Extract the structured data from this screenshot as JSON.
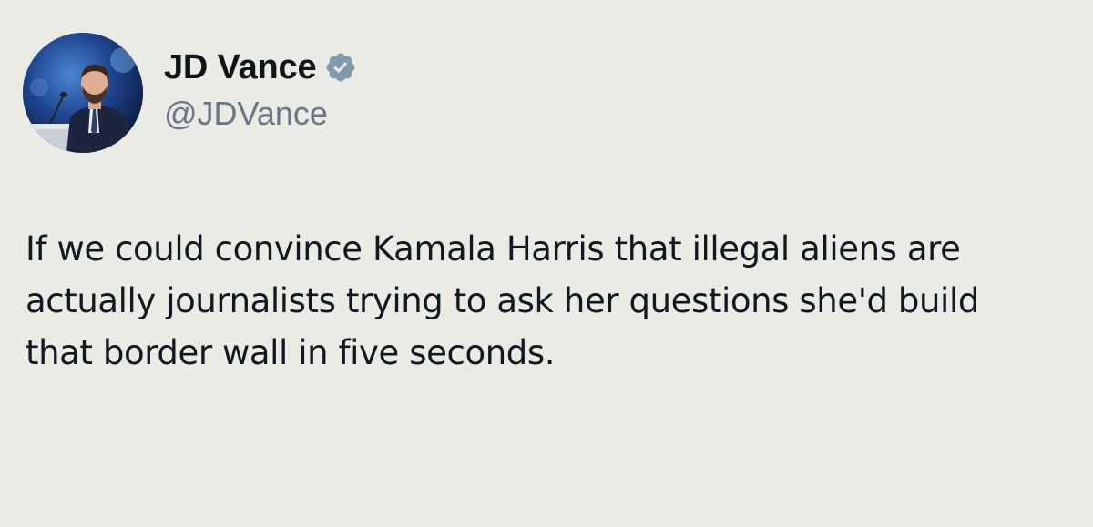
{
  "author": {
    "display_name": "JD Vance",
    "handle": "@JDVance",
    "verified_icon": "verified-badge-icon"
  },
  "tweet": {
    "text": "If we could convince Kamala Harris that illegal aliens are actually journalists trying to ask her questions she'd build that border wall in five seconds."
  },
  "colors": {
    "background": "#ebebe6",
    "text": "#111820",
    "handle": "#6b7784",
    "verified_badge": "#829aab"
  }
}
